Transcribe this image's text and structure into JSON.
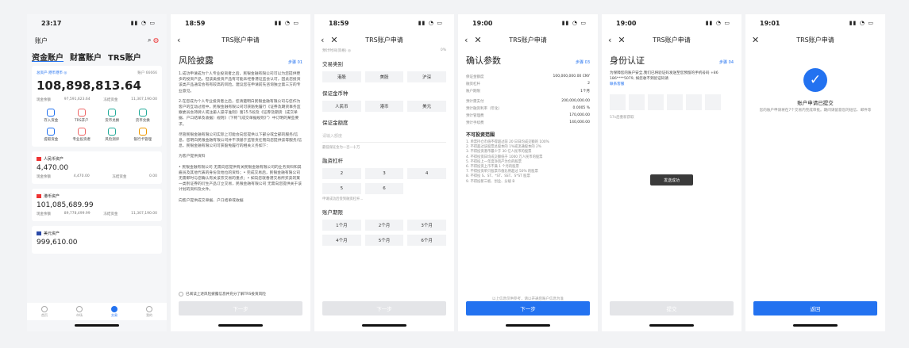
{
  "phone1": {
    "status_time": "23:17",
    "nav_title": "账户",
    "tabs": [
      "资金账户",
      "财富账户",
      "TRS账户"
    ],
    "account_label": "总资产·港币港币 ◎",
    "account_id": "账户 66666",
    "total": "108,898,813.64",
    "cash_label": "现金余额",
    "cash_value": "97,591,623.64",
    "frozen_label": "冻结资金",
    "frozen_value": "11,307,190.00",
    "grid": [
      "存入资金",
      "TRS开户",
      "货币兑换",
      "货币兑换",
      "提取资金",
      "专业投资者",
      "风险测评",
      "银行卡管理"
    ],
    "cny_name": "人民币资产",
    "cny_value": "4,470.00",
    "cny_row": [
      "现金余额",
      "4,470.00",
      "冻结资金",
      "0.00"
    ],
    "hkd_name": "港币资产",
    "hkd_value": "101,085,689.99",
    "hkd_row": [
      "现金余额",
      "89,778,499.99",
      "冻结资金",
      "11,307,190.00"
    ],
    "usd_name": "美元资产",
    "usd_value": "999,610.00",
    "bottom_tabs": [
      "首页",
      "市场",
      "交易",
      "我的"
    ]
  },
  "phone2": {
    "status_time": "18:59",
    "nav_title": "TRS账户申请",
    "heading": "风险披露",
    "step": "步骤 01",
    "paras": [
      "1.成功申请成为个人专业投资者之后，民银金融有限公司可以为您提供更多的投资产品，但该类投资产品有可能未经香港证监会认可，因此您投资该类产品通常会有有较高的风险。建议您在申请前先咨询独立第三方的专业意见。",
      "2.在您成为个人专业投资者之后，您清楚明白民银金融有限公司与您作为客户的互动过程中，民银金融有限公司可获豁免履行《证券及期货事务监察委员会持牌人或注册人操守准则》第15.5段及《证券及期货（成交单据、户口结单及收据）规则》（下称“《成交单据规则》”）中订明的某些要求。",
      "尽管民银金融有限公司实际上可能会向您提供以下部分或全部的服务/信息，您明白民银金融有限公司并不须基于监管责任而向您提供该等服务/信息，民银金融有限公司可获豁免履行的相关义务如下：",
      "为客户提供资料",
      "• 民银金融有限公司 无需向您提供有关民银金融有限公司的业务资料和其雇员及其他代表的身份及地位的资料；• 完成交易后，民银金融有限公司 无需即时与您确认有关该宗交易的重点；• 如向您就香港交易所买卖的某一类别证券的衍生产品订立交易，民银金融有限公司 无需向您提供关于该计划的资料及文件。",
      "向客户提供成交单据、户口结单或收据"
    ],
    "agree": "已阅读上述风险披露信息并充分了解TRS投资风险",
    "button": "下一步"
  },
  "phone3": {
    "status_time": "18:59",
    "nav_title": "TRS账户申请",
    "progress_label": "预计时间(资格) ◎",
    "progress_value": "0%",
    "sec1": "交易类别",
    "sec1_opts": [
      "港股",
      "美股",
      "沪深"
    ],
    "sec2": "保证金币种",
    "sec2_opts": [
      "人民币",
      "港币",
      "美元"
    ],
    "sec3": "保证金额度",
    "amount_placeholder": "请输入额度",
    "amount_hint": "最低保证金为一百一十万",
    "sec4": "融资杠杆",
    "sec4_opts": [
      "2",
      "3",
      "4",
      "5",
      "6"
    ],
    "lever_hint": "申请成功后受到融资杠杆...",
    "sec5": "账户期限",
    "sec5_opts": [
      "1个月",
      "2个月",
      "3个月",
      "4个月",
      "5个月",
      "6个月"
    ],
    "button": "下一步"
  },
  "phone4": {
    "status_time": "19:00",
    "nav_title": "TRS账户申请",
    "heading": "确认参数",
    "step": "步骤 03",
    "kv1": [
      [
        "保证金额度",
        "100,000,000.00 CNY"
      ],
      [
        "融资杠杆",
        "2"
      ],
      [
        "账户期限",
        "1个月"
      ]
    ],
    "kv2": [
      [
        "预计需支付",
        "200,000,000.00"
      ],
      [
        "预计融资利率（年化）",
        "0.0005 %"
      ],
      [
        "预计管理费",
        "170,000.00"
      ],
      [
        "预计手续费",
        "140,000.00"
      ]
    ],
    "scope_title": "不可投资范围",
    "scope": [
      "1. 单票持仓市值不得超过前 20 日日均成交额的 100%",
      "2. 不得超过该股票总股本的 1%或流通股本的 2%",
      "3. 不得投资港币最少于 30 亿人民币的股票",
      "4. 不得投资日均成交额低于 1000 万人民币的股票",
      "5. 不得投上一年度净资产为负的股票",
      "6. 不得投资上市不满 1 个月的股票",
      "7. 不得投资单只股票市值比例超过 50% 的股票",
      "8. 不得投 S、ST、*ST、SST、S*ST 股票",
      "9. 不得投新三板、创业、分级 B"
    ],
    "foot": "以上信息仅供参考，请以开通后账户信息为准",
    "button": "下一步"
  },
  "phone5": {
    "status_time": "19:00",
    "nav_title": "TRS账户申请",
    "heading": "身份认证",
    "step": "步骤 04",
    "desc": "为保障您的账户安全,我们已将验证码发送至您预留的手机号码 +86 186****5079, 如您收不到验证码请",
    "link": "联系客服",
    "resend": "57s后重新获取",
    "toast": "发送成功",
    "button": "提交"
  },
  "phone6": {
    "status_time": "19:01",
    "nav_title": "TRS账户申请",
    "done": "账户申请已提交",
    "sub": "您的账户申请将在7个交易内完成审批。期间请留意您的短信、邮件等",
    "button": "返回"
  }
}
